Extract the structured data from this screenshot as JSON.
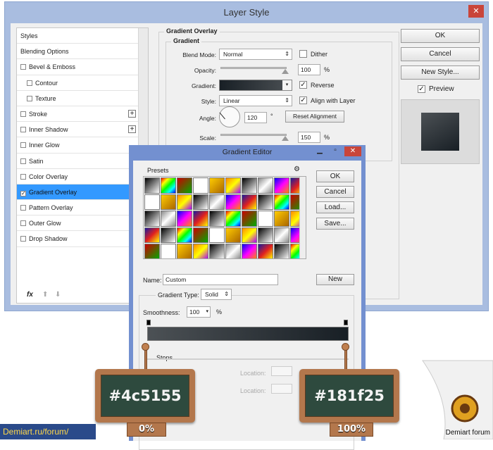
{
  "layer_style": {
    "title": "Layer Style",
    "close": "✕",
    "items": [
      {
        "label": "Styles",
        "cb": false,
        "checked": false
      },
      {
        "label": "Blending Options",
        "cb": false,
        "checked": false
      },
      {
        "label": "Bevel & Emboss",
        "cb": true,
        "checked": false
      },
      {
        "label": "Contour",
        "cb": true,
        "checked": false,
        "indent": true
      },
      {
        "label": "Texture",
        "cb": true,
        "checked": false,
        "indent": true
      },
      {
        "label": "Stroke",
        "cb": true,
        "checked": false,
        "plus": true
      },
      {
        "label": "Inner Shadow",
        "cb": true,
        "checked": false,
        "plus": true
      },
      {
        "label": "Inner Glow",
        "cb": true,
        "checked": false
      },
      {
        "label": "Satin",
        "cb": true,
        "checked": false
      },
      {
        "label": "Color Overlay",
        "cb": true,
        "checked": false
      },
      {
        "label": "Gradient Overlay",
        "cb": true,
        "checked": true,
        "selected": true
      },
      {
        "label": "Pattern Overlay",
        "cb": true,
        "checked": false
      },
      {
        "label": "Outer Glow",
        "cb": true,
        "checked": false
      },
      {
        "label": "Drop Shadow",
        "cb": true,
        "checked": false
      }
    ],
    "fx": "fx",
    "section_title": "Gradient Overlay",
    "group_title": "Gradient",
    "blend_mode_label": "Blend Mode:",
    "blend_mode": "Normal",
    "dither": "Dither",
    "opacity_label": "Opacity:",
    "opacity": "100",
    "pct": "%",
    "gradient_label": "Gradient:",
    "reverse": "Reverse",
    "style_label": "Style:",
    "style": "Linear",
    "align": "Align with Layer",
    "angle_label": "Angle:",
    "angle": "120",
    "deg": "°",
    "reset": "Reset Alignment",
    "scale_label": "Scale:",
    "scale": "150",
    "ok": "OK",
    "cancel": "Cancel",
    "new_style": "New Style...",
    "preview": "Preview"
  },
  "gradient_editor": {
    "title": "Gradient Editor",
    "presets": "Presets",
    "ok": "OK",
    "cancel": "Cancel",
    "load": "Load...",
    "save": "Save...",
    "name_label": "Name:",
    "name": "Custom",
    "new": "New",
    "type_label": "Gradient Type:",
    "type": "Solid",
    "smooth_label": "Smoothness:",
    "smooth": "100",
    "pct": "%",
    "stops": "Stops",
    "location": "Location:",
    "colors": {
      "start": "#4c5155",
      "end": "#181f25"
    }
  },
  "annotations": {
    "left_hex": "#4c5155",
    "left_pos": "0%",
    "right_hex": "#181f25",
    "right_pos": "100%",
    "site": "Demiart.ru/forum/",
    "logo": "Demiart forum"
  }
}
